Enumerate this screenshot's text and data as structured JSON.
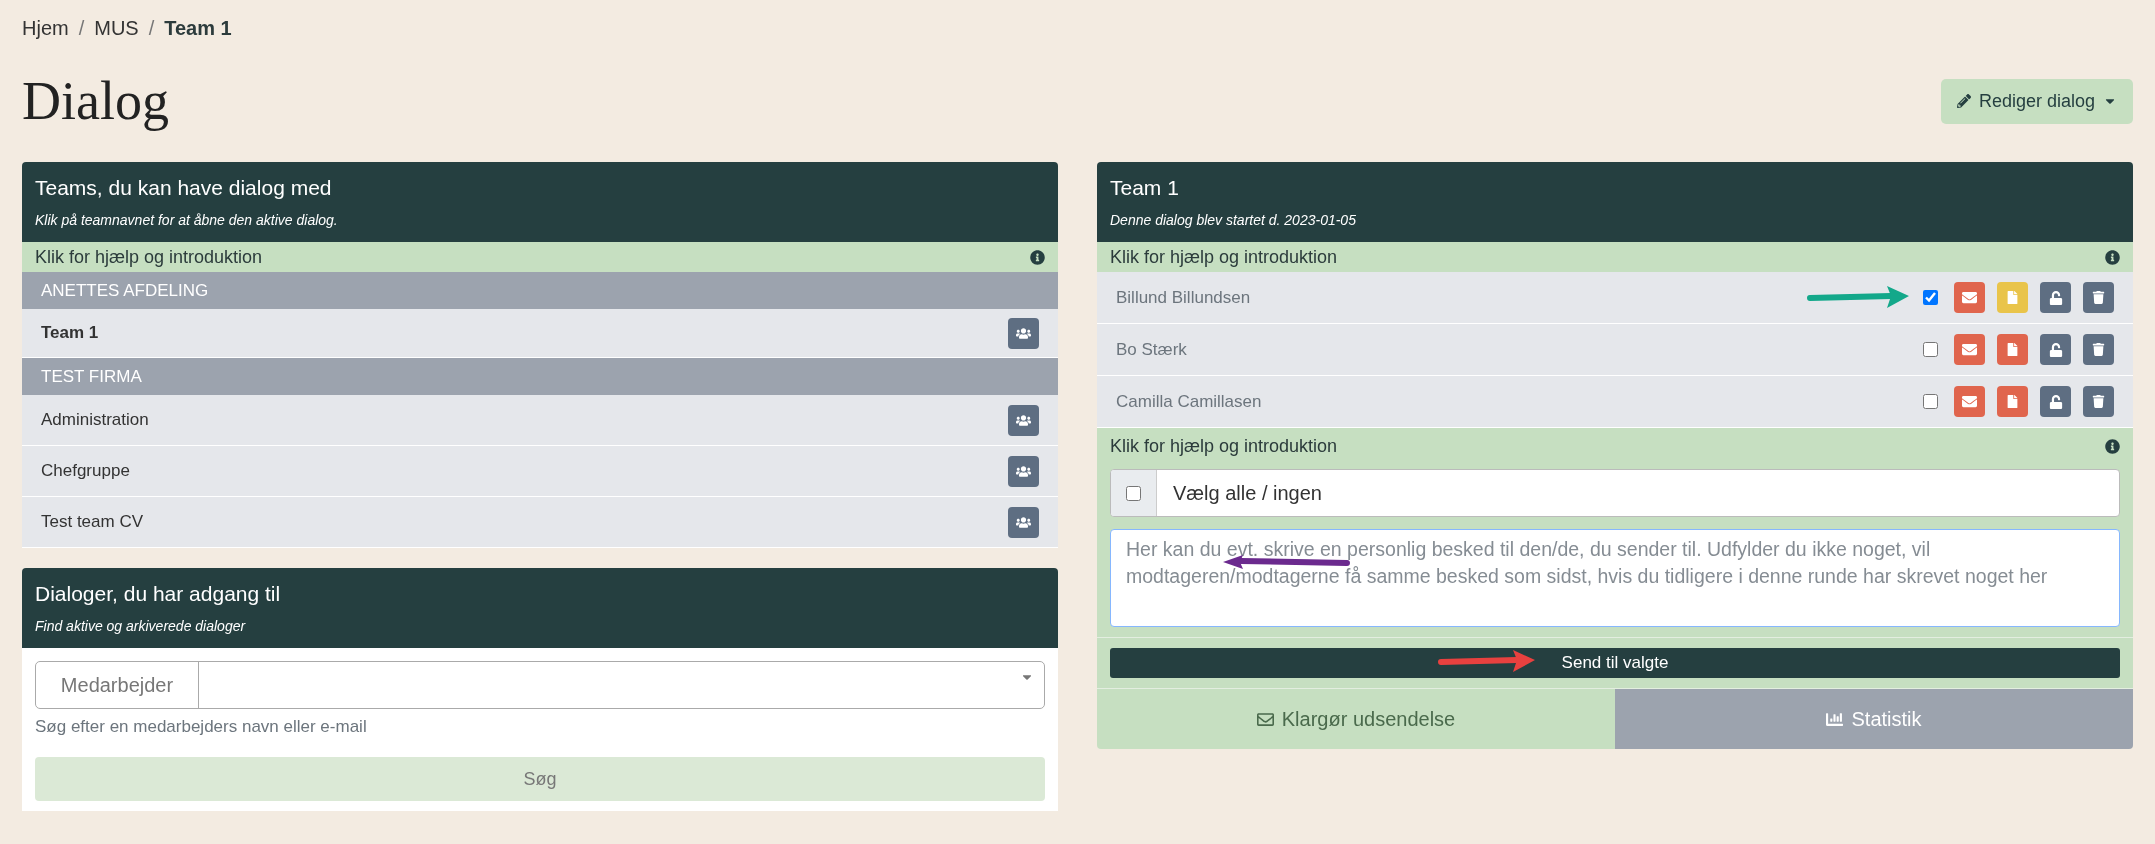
{
  "breadcrumb": [
    {
      "label": "Hjem",
      "current": false
    },
    {
      "label": "MUS",
      "current": false,
      "separator": "/"
    },
    {
      "label": "Team 1",
      "current": true,
      "separator": "/"
    }
  ],
  "page_title": "Dialog",
  "edit_button": {
    "label": "Rediger dialog"
  },
  "teams_panel": {
    "title": "Teams, du kan have dialog med",
    "subtitle": "Klik på teamnavnet for at åbne den aktive dialog.",
    "help": "Klik for hjælp og introduktion",
    "groups": [
      {
        "name": "ANETTES AFDELING",
        "teams": [
          {
            "name": "Team 1",
            "selected": true
          }
        ]
      },
      {
        "name": "TEST FIRMA",
        "teams": [
          {
            "name": "Administration",
            "selected": false
          },
          {
            "name": "Chefgruppe",
            "selected": false
          },
          {
            "name": "Test team CV",
            "selected": false
          }
        ]
      }
    ]
  },
  "dialogs_panel": {
    "title": "Dialoger, du har adgang til",
    "subtitle": "Find aktive og arkiverede dialoger",
    "field_label": "Medarbejder",
    "hint": "Søg efter en medarbejders navn eller e-mail",
    "search_button": "Søg"
  },
  "dialog_panel": {
    "title": "Team 1",
    "subtitle": "Denne dialog blev startet d. 2023-01-05",
    "help": "Klik for hjælp og introduktion",
    "participants": [
      {
        "name": "Billund Billundsen",
        "checked": true,
        "color": "#e9c44a"
      },
      {
        "name": "Bo Stærk",
        "checked": false,
        "color": "#e0654d"
      },
      {
        "name": "Camilla Camillasen",
        "checked": false,
        "color": "#e0654d"
      }
    ],
    "help_2": "Klik for hjælp og introduktion",
    "select_all": {
      "label": "Vælg alle / ingen",
      "checked": false
    },
    "message": {
      "placeholder": "Her kan du evt. skrive en personlig besked til den/de, du sender til. Udfylder du ikke noget, vil modtageren/modtagerne få samme besked som sidst, hvis du tidligere i denne runde har skrevet noget her"
    },
    "send_button": "Send til valgte",
    "tabs": [
      {
        "label": "Klargør udsendelse",
        "kind": "envelope",
        "selected": true
      },
      {
        "label": "Statistik",
        "kind": "chart",
        "selected": false
      }
    ]
  }
}
